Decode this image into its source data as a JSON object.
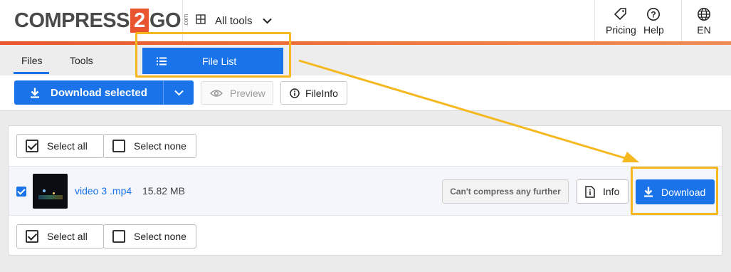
{
  "header": {
    "logo": {
      "part1": "COMPRESS",
      "badge": "2",
      "part2": "GO",
      "suffix": ".com"
    },
    "all_tools_label": "All tools",
    "pricing_label": "Pricing",
    "help_label": "Help",
    "language_label": "EN"
  },
  "tabs": [
    {
      "label": "Files",
      "active": true
    },
    {
      "label": "Tools",
      "active": false
    }
  ],
  "dropdown": {
    "item_label": "File List"
  },
  "toolbar": {
    "download_selected_label": "Download selected",
    "preview_label": "Preview",
    "fileinfo_label": "FileInfo"
  },
  "file_list": {
    "select_all_label": "Select all",
    "select_none_label": "Select none",
    "files": [
      {
        "name": "video 3 .mp4",
        "size": "15.82 MB",
        "checked": true,
        "status": "Can't compress any further",
        "info_label": "Info",
        "download_label": "Download"
      }
    ]
  },
  "colors": {
    "accent_blue": "#1a73e8",
    "brand_orange": "#e8552e",
    "annotation_yellow": "#f5b820"
  },
  "icons": [
    "grid-icon",
    "chevron-down-icon",
    "tag-icon",
    "help-circle-icon",
    "globe-icon",
    "list-icon",
    "download-icon",
    "eye-icon",
    "info-icon"
  ]
}
